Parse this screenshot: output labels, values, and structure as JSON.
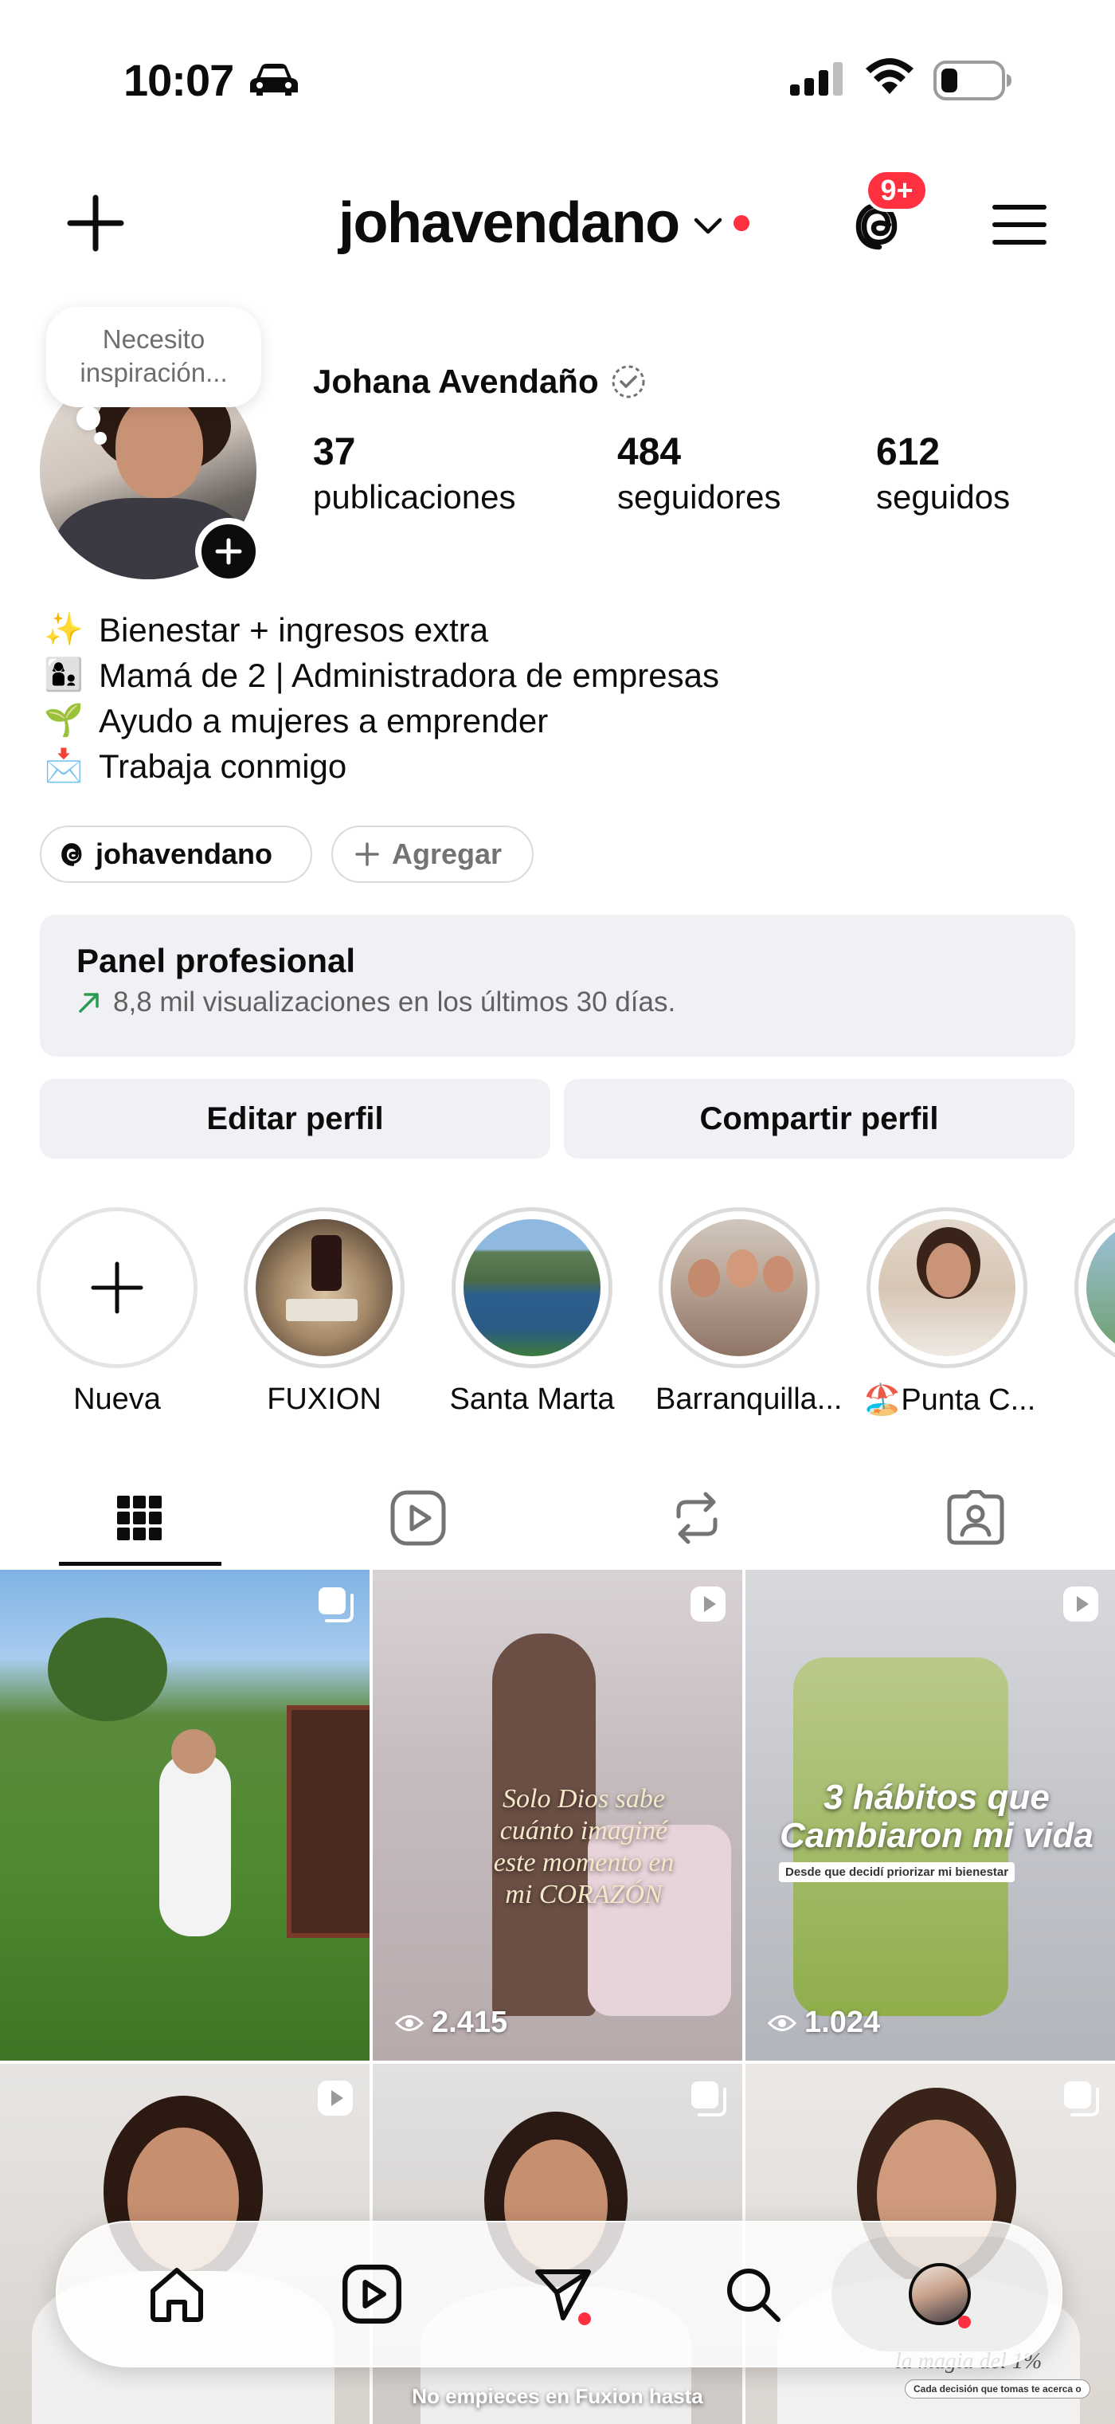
{
  "status_bar": {
    "time": "10:07",
    "icons": [
      "car-icon",
      "signal-icon",
      "wifi-icon",
      "battery-icon"
    ]
  },
  "header": {
    "username": "johavendano",
    "notification_badge": "9+"
  },
  "profile": {
    "note": "Necesito inspiración...",
    "full_name": "Johana Avendaño",
    "stats": [
      {
        "value": "37",
        "label": "publicaciones"
      },
      {
        "value": "484",
        "label": "seguidores"
      },
      {
        "value": "612",
        "label": "seguidos"
      }
    ],
    "bio": [
      {
        "emoji": "✨",
        "text": "Bienestar + ingresos extra"
      },
      {
        "emoji": "👩‍👦",
        "text": "Mamá de 2 | Administradora de empresas"
      },
      {
        "emoji": "🌱",
        "text": "Ayudo a mujeres a emprender"
      },
      {
        "emoji": "📩",
        "text": "Trabaja conmigo"
      }
    ],
    "threads_link": "johavendano",
    "add_link": "Agregar"
  },
  "panel": {
    "title": "Panel profesional",
    "subtitle": "8,8 mil visualizaciones en los últimos 30 días."
  },
  "buttons": {
    "edit": "Editar perfil",
    "share": "Compartir perfil"
  },
  "highlights": [
    {
      "label": "Nueva"
    },
    {
      "label": "FUXION"
    },
    {
      "label": "Santa Marta"
    },
    {
      "label": "Barranquilla..."
    },
    {
      "label": "🏖️Punta C..."
    }
  ],
  "posts": [
    {
      "type": "carousel",
      "views": ""
    },
    {
      "type": "reel",
      "views": "2.415",
      "overlay": "Solo Dios sabe cuánto imaginé este momento en mi CORAZÓN"
    },
    {
      "type": "reel",
      "views": "1.024",
      "overlay_title": "3 hábitos que Cambiaron mi vida",
      "overlay_sub": "Desde que decidí priorizar mi bienestar"
    },
    {
      "type": "reel",
      "views": ""
    },
    {
      "type": "carousel",
      "views": "",
      "overlay": "No empieces en Fuxion hasta"
    },
    {
      "type": "carousel",
      "views": "",
      "overlay": "la magia del 1%",
      "overlay_sub": "Cada decisión que tomas te acerca o"
    }
  ],
  "colors": {
    "accent_red": "#ff3040",
    "panel_bg": "#eff1f4",
    "text": "#0c0c0c",
    "muted": "#737373"
  }
}
